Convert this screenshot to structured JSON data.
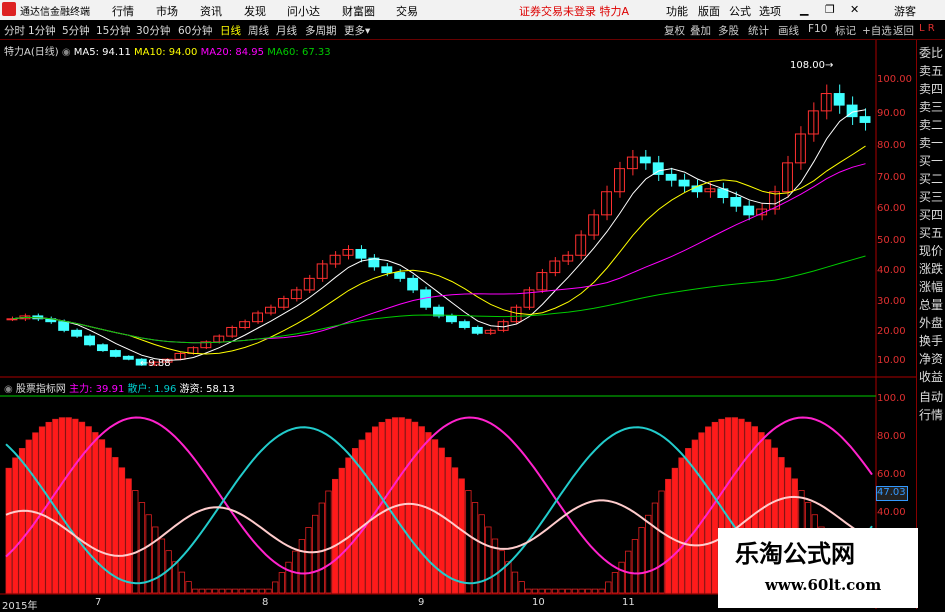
{
  "app": {
    "name": "通达信金融终端",
    "menu": [
      "行情",
      "市场",
      "资讯",
      "发现",
      "问小达",
      "财富圈",
      "交易"
    ],
    "status": "证券交易未登录",
    "stock_title": "特力A",
    "right_buttons": [
      "功能",
      "版面",
      "公式",
      "选项"
    ],
    "guest": "游客"
  },
  "toolbar": {
    "periods": [
      "分时",
      "1分钟",
      "5分钟",
      "15分钟",
      "30分钟",
      "60分钟",
      "日线",
      "周线",
      "月线",
      "多周期",
      "更多"
    ],
    "active_period": "日线",
    "right": [
      "复权",
      "叠加",
      "多股",
      "统计",
      "画线",
      "F10",
      "标记",
      "+自选",
      "返回"
    ]
  },
  "price_panel": {
    "label": "特力A(日线)",
    "ma": [
      {
        "name": "MA5",
        "value": "94.11",
        "color": "#ffffff"
      },
      {
        "name": "MA10",
        "value": "94.00",
        "color": "#ffff00"
      },
      {
        "name": "MA20",
        "value": "84.95",
        "color": "#ff00ff"
      },
      {
        "name": "MA60",
        "value": "67.33",
        "color": "#00cc00"
      }
    ],
    "annotations": {
      "high": "108.00",
      "low": "9.88"
    }
  },
  "indicator_panel": {
    "label": "股票指标网",
    "series": [
      {
        "name": "主力",
        "value": "39.91",
        "color": "#ff00ff"
      },
      {
        "name": "散户",
        "value": "1.96",
        "color": "#00cccc"
      },
      {
        "name": "游资",
        "value": "58.13",
        "color": "#ffffff"
      }
    ],
    "current_value": "47.03"
  },
  "side_panel": {
    "items": [
      "委比",
      "卖五",
      "卖四",
      "卖三",
      "卖二",
      "卖一",
      "买一",
      "买二",
      "买三",
      "买四",
      "买五",
      "现价",
      "涨跌",
      "涨幅",
      "总量",
      "外盘",
      "换手",
      "净资",
      "收益",
      "自动",
      "行情"
    ],
    "corner": [
      "L",
      "R"
    ]
  },
  "time_axis": [
    "2015年",
    "7",
    "8",
    "9",
    "10",
    "11"
  ],
  "watermark": {
    "title": "乐淘公式网",
    "url": "www.60lt.com"
  },
  "chart_data": [
    {
      "type": "candlestick",
      "title": "特力A(日线)",
      "yticks": [
        20,
        30,
        40,
        50,
        60,
        70,
        80,
        90,
        100
      ],
      "ylim": [
        10,
        108
      ],
      "close": [
        26,
        27,
        26,
        25,
        22,
        20,
        17,
        15,
        13,
        12,
        10,
        11,
        12,
        14,
        16,
        18,
        20,
        23,
        25,
        28,
        30,
        33,
        36,
        40,
        45,
        48,
        50,
        47,
        44,
        42,
        40,
        36,
        30,
        27,
        25,
        23,
        21,
        22,
        25,
        30,
        36,
        42,
        46,
        48,
        55,
        62,
        70,
        78,
        82,
        80,
        76,
        74,
        72,
        70,
        71,
        68,
        65,
        62,
        64,
        70,
        80,
        90,
        98,
        104,
        100,
        96,
        94
      ]
    },
    {
      "type": "bar",
      "title": "股票指标网",
      "yticks": [
        40,
        60,
        80,
        100
      ],
      "ylim": [
        0,
        100
      ]
    }
  ]
}
